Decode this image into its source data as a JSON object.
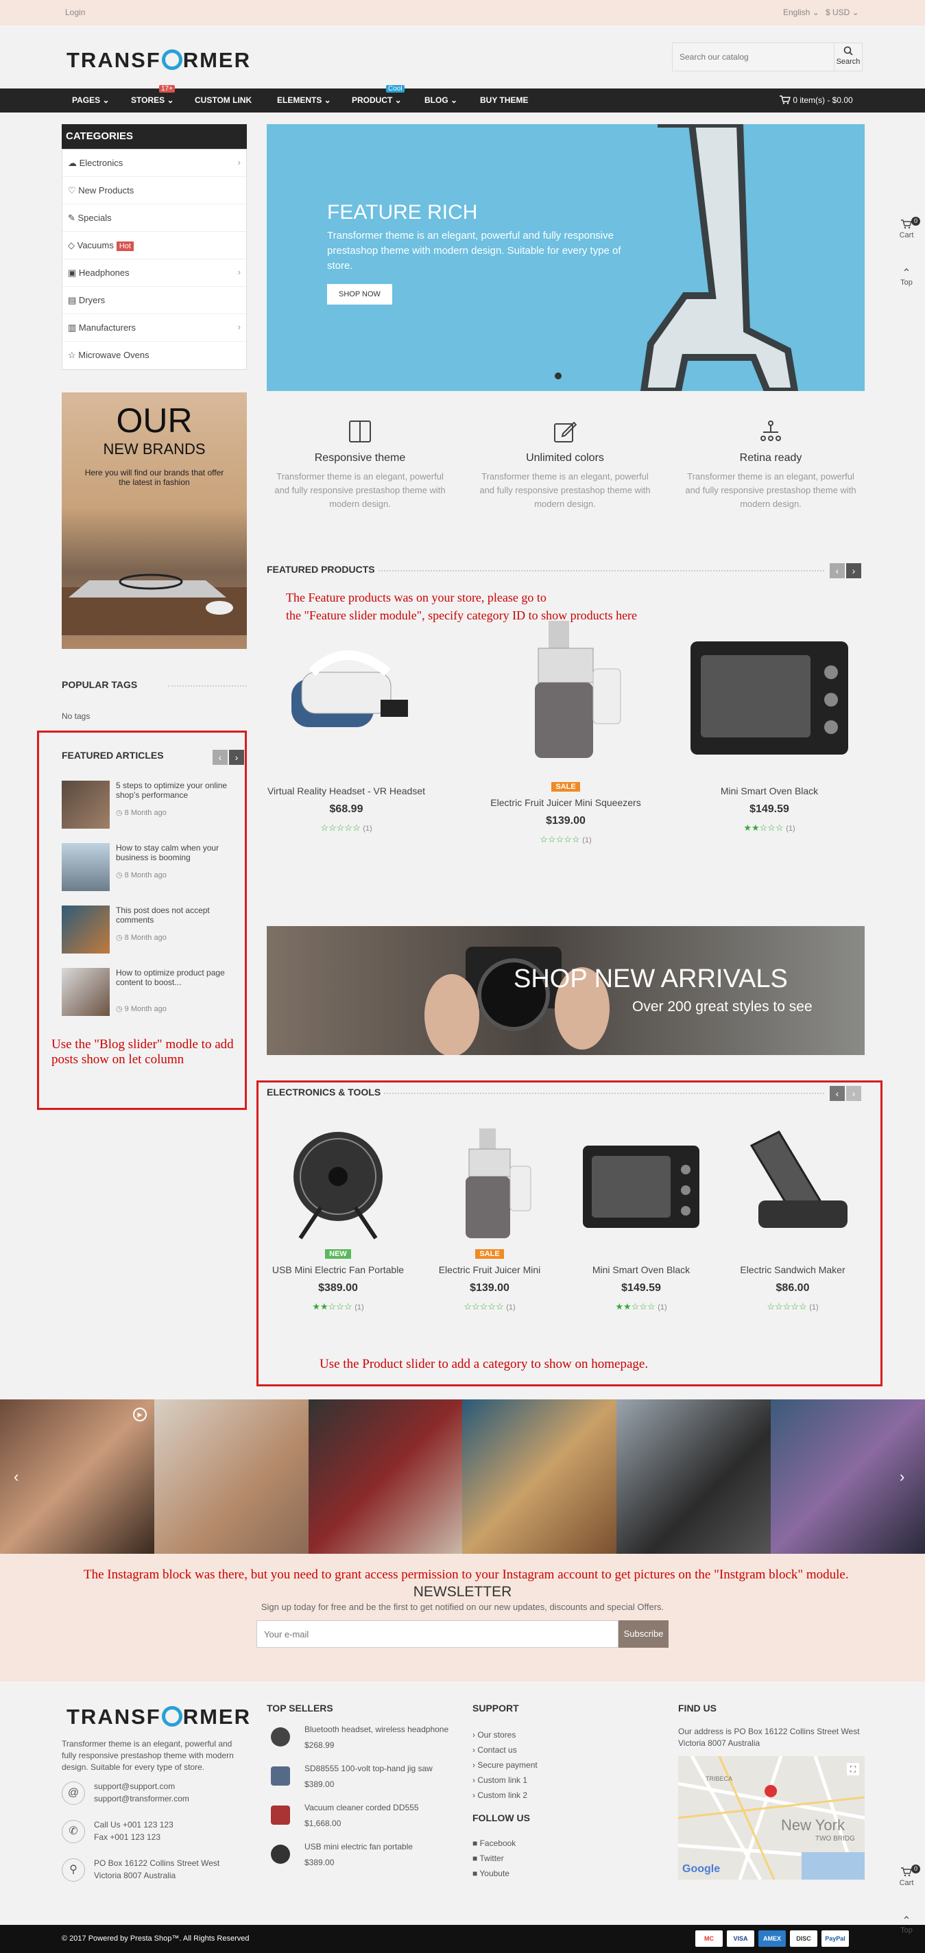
{
  "topbar": {
    "login": "Login",
    "language": "English ⌄",
    "currency": "$ USD ⌄"
  },
  "header": {
    "logo_left": "TRANSF",
    "logo_right": "RMER",
    "search_placeholder": "Search our catalog",
    "search_label": "Search"
  },
  "nav": {
    "items": [
      "PAGES ⌄",
      "STORES ⌄",
      "CUSTOM LINK",
      "ELEMENTS ⌄",
      "PRODUCT ⌄",
      "BLOG ⌄",
      "BUY THEME"
    ],
    "stores_badge": "17+",
    "product_badge": "Cool",
    "cart": "0 item(s) - $0.00"
  },
  "categories": {
    "title": "CATEGORIES",
    "items": [
      "Electronics",
      "New Products",
      "Specials",
      "Vacuums",
      "Headphones",
      "Dryers",
      "Manufacturers",
      "Microwave Ovens"
    ],
    "hot_label": "Hot"
  },
  "brands": {
    "line1": "OUR",
    "line2": "NEW BRANDS",
    "line3": "Here you will find our brands that offer the latest in fashion"
  },
  "popular_tags": {
    "title": "POPULAR TAGS",
    "text": "No tags"
  },
  "featured_articles": {
    "title": "FEATURED ARTICLES",
    "items": [
      {
        "title": "5 steps to optimize your online shop's performance",
        "time": "8 Month ago"
      },
      {
        "title": "How to stay calm when your business is booming",
        "time": "8 Month ago"
      },
      {
        "title": "This post does not accept comments",
        "time": "8 Month ago"
      },
      {
        "title": "How to optimize product page content to boost...",
        "time": "9 Month ago"
      }
    ],
    "note": "Use the \"Blog slider\" modle to add posts show on let column"
  },
  "slider": {
    "title": "FEATURE RICH",
    "text": "Transformer theme is an elegant, powerful and fully responsive prestashop theme with modern design. Suitable for every type of store.",
    "button": "SHOP NOW"
  },
  "features": [
    {
      "title": "Responsive theme",
      "text": "Transformer theme is an elegant, powerful and fully responsive prestashop theme with modern design."
    },
    {
      "title": "Unlimited colors",
      "text": "Transformer theme is an elegant, powerful and fully responsive prestashop theme with modern design."
    },
    {
      "title": "Retina ready",
      "text": "Transformer theme is an elegant, powerful and fully responsive prestashop theme with modern design."
    }
  ],
  "featured_products": {
    "title": "FEATURED PRODUCTS",
    "note_line1": "The Feature products was on your store, please go to",
    "note_line2": "the \"Feature slider module\", specify category ID to show products here",
    "items": [
      {
        "name": "Virtual Reality Headset - VR Headset",
        "price": "$68.99",
        "badge": "",
        "reviews": "(1)"
      },
      {
        "name": "Electric Fruit Juicer Mini Squeezers",
        "price": "$139.00",
        "badge": "SALE",
        "reviews": "(1)"
      },
      {
        "name": "Mini Smart Oven Black",
        "price": "$149.59",
        "badge": "",
        "reviews": "(1)"
      }
    ]
  },
  "banner": {
    "title": "SHOP NEW ARRIVALS",
    "subtitle": "Over 200 great styles to see"
  },
  "electronics": {
    "title": "ELECTRONICS & TOOLS",
    "items": [
      {
        "name": "USB Mini Electric Fan Portable",
        "price": "$389.00",
        "badge": "NEW",
        "reviews": "(1)"
      },
      {
        "name": "Electric Fruit Juicer Mini",
        "price": "$139.00",
        "badge": "SALE",
        "reviews": "(1)"
      },
      {
        "name": "Mini Smart Oven Black",
        "price": "$149.59",
        "badge": "",
        "reviews": "(1)"
      },
      {
        "name": "Electric Sandwich Maker",
        "price": "$86.00",
        "badge": "",
        "reviews": "(1)"
      }
    ],
    "note": "Use the Product slider to add a category to show on homepage."
  },
  "instagram_note": "The Instagram block was there, but you need to grant access permission to your Instagram account to get pictures on the \"Instgram block\" module.",
  "newsletter": {
    "title": "NEWSLETTER",
    "text": "Sign up today for free and be the first to get notified on our new updates, discounts and special Offers.",
    "placeholder": "Your e-mail",
    "button": "Subscribe"
  },
  "footer": {
    "about": "Transformer theme is an elegant, powerful and fully responsive prestashop theme with modern design. Suitable for every type of store.",
    "email1": "support@support.com",
    "email2": "support@transformer.com",
    "phone1": "Call Us +001 123 123",
    "phone2": "Fax +001 123 123",
    "addr1": "PO Box 16122 Collins Street West",
    "addr2": "Victoria 8007 Australia",
    "top_sellers_title": "TOP SELLERS",
    "top_sellers": [
      {
        "name": "Bluetooth headset, wireless headphone",
        "price": "$268.99"
      },
      {
        "name": "SD88555 100-volt top-hand jig saw",
        "price": "$389.00"
      },
      {
        "name": "Vacuum cleaner corded DD555",
        "price": "$1,668.00"
      },
      {
        "name": "USB mini electric fan portable",
        "price": "$389.00"
      }
    ],
    "support_title": "SUPPORT",
    "support_links": [
      "Our stores",
      "Contact us",
      "Secure payment",
      "Custom link 1",
      "Custom link 2"
    ],
    "follow_title": "FOLLOW US",
    "follow_links": [
      "Facebook",
      "Twitter",
      "Youbute"
    ],
    "find_title": "FIND US",
    "find_text": "Our address is PO Box 16122 Collins Street West Victoria 8007 Australia",
    "map_label1": "TRIBECA",
    "map_label2": "New York",
    "map_label3": "TWO BRIDG",
    "map_google": "Google"
  },
  "side": {
    "cart": "Cart",
    "cart_count": "0",
    "top": "Top"
  },
  "copyright": "© 2017 Powered by Presta Shop™. All Rights Reserved",
  "payments": [
    "MC",
    "VISA",
    "AMEX",
    "DISC",
    "PayPal"
  ],
  "colors": {
    "accent": "#2a9fd6",
    "dark": "#252525",
    "note_red": "#c00",
    "star_green": "#3aa83a",
    "sale": "#f08a24",
    "new": "#5cb85c"
  }
}
